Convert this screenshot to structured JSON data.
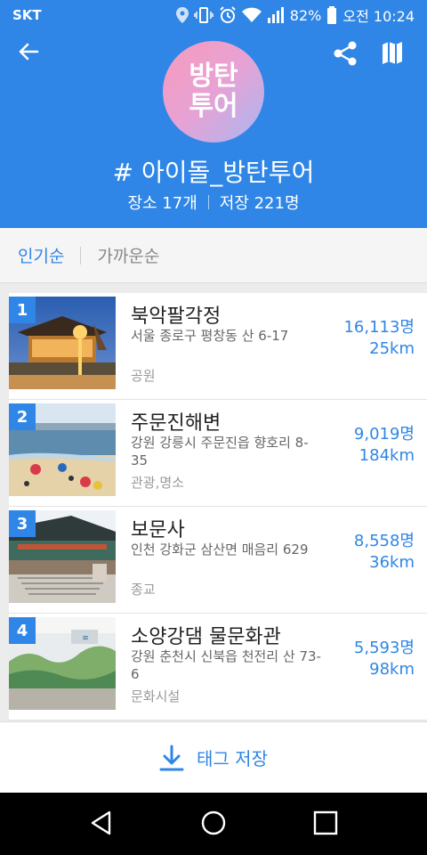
{
  "status_bar": {
    "carrier": "SKT",
    "battery": "82%",
    "time": "오전 10:24",
    "icons": [
      "location-icon",
      "vibrate-icon",
      "alarm-icon",
      "wifi-icon",
      "signal-icon",
      "battery-icon"
    ]
  },
  "header": {
    "logo_line1": "방탄",
    "logo_line2": "투어",
    "tag_title": "# 아이돌_방탄투어",
    "places": "장소 17개",
    "saves": "저장 221명",
    "colors": {
      "primary": "#2f86e6"
    }
  },
  "sort": {
    "popular": "인기순",
    "nearest": "가까운순"
  },
  "places": [
    {
      "rank": "1",
      "name": "북악팔각정",
      "address": "서울 종로구 평창동 산 6-17",
      "category": "공원",
      "count": "16,113명",
      "distance": "25km"
    },
    {
      "rank": "2",
      "name": "주문진해변",
      "address": "강원 강릉시 주문진읍 향호리 8-35",
      "category": "관광,명소",
      "count": "9,019명",
      "distance": "184km"
    },
    {
      "rank": "3",
      "name": "보문사",
      "address": "인천 강화군 삼산면 매음리 629",
      "category": "종교",
      "count": "8,558명",
      "distance": "36km"
    },
    {
      "rank": "4",
      "name": "소양강댐 물문화관",
      "address": "강원 춘천시 신북읍 천전리 산 73-6",
      "category": "문화시설",
      "count": "5,593명",
      "distance": "98km"
    }
  ],
  "save_button": {
    "label": "태그 저장"
  }
}
